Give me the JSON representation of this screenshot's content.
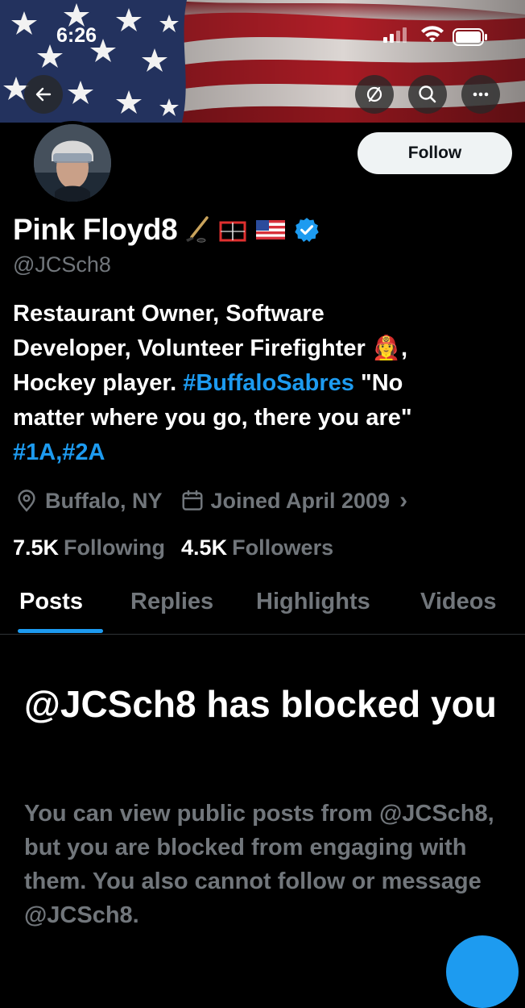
{
  "status_bar": {
    "time": "6:26"
  },
  "icons": {
    "back": "back-arrow-icon",
    "repost": "no-repost-icon",
    "search": "search-icon",
    "more": "more-icon",
    "location": "location-icon",
    "calendar": "calendar-icon",
    "verified": "verified-badge-icon"
  },
  "profile": {
    "display_name": "Pink Floyd8",
    "name_emojis": [
      "🏒",
      "🥅",
      "🇺🇸"
    ],
    "handle": "@JCSch8",
    "follow_label": "Follow",
    "bio": {
      "line1": "Restaurant Owner, Software",
      "line2_pre": "Developer, Volunteer Firefighter ",
      "line2_emoji": "👩‍🚒",
      "line2_post": ",",
      "line3_pre": "Hockey player. ",
      "hashtag1": "#BuffaloSabres",
      "line3_post": " \"No",
      "line4": "matter where you go, there you are\"",
      "hashtag2": "#1A",
      "comma": ",",
      "hashtag3": "#2A"
    },
    "location": "Buffalo, NY",
    "joined": "Joined April 2009",
    "chevron": "›",
    "following_count": "7.5K",
    "following_label": "Following",
    "followers_count": "4.5K",
    "followers_label": "Followers"
  },
  "tabs": [
    {
      "label": "Posts",
      "active": true
    },
    {
      "label": "Replies",
      "active": false
    },
    {
      "label": "Highlights",
      "active": false
    },
    {
      "label": "Videos",
      "active": false
    }
  ],
  "blocked": {
    "title": "@JCSch8 has blocked you",
    "body": "You can view public posts from @JCSch8, but you are blocked from engaging with them. You also cannot follow or message @JCSch8."
  },
  "colors": {
    "accent": "#1d9bf0",
    "background": "#000000",
    "muted_text": "#71767b",
    "primary_text": "#ffffff"
  }
}
